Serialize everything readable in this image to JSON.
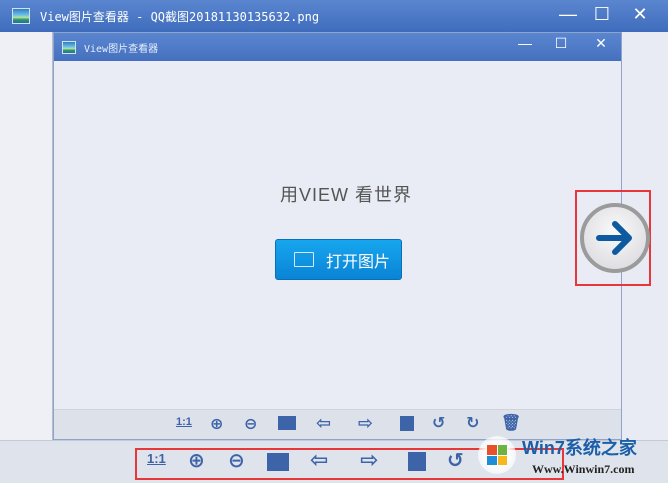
{
  "window": {
    "title": "View图片查看器 - QQ截图20181130135632.png",
    "minimize": "—",
    "maximize": "☐",
    "close": "✕"
  },
  "inner_window": {
    "title": "View图片查看器",
    "minimize": "—",
    "maximize": "☐",
    "close": "✕"
  },
  "main": {
    "slogan": "用VIEW 看世界",
    "open_button": "打开图片"
  },
  "toolbar": {
    "actual_size": "1:1",
    "items": [
      "actual-size",
      "zoom-in",
      "zoom-out",
      "open-folder",
      "previous",
      "next",
      "save",
      "rotate-left",
      "rotate-right",
      "delete"
    ]
  },
  "watermark": {
    "brand": "Win7系统之家",
    "url": "Www.Winwin7.com"
  },
  "colors": {
    "titlebar": "#4a76c4",
    "accent": "#0a84d6",
    "highlight": "#e8373a",
    "icon": "#3d64a8"
  }
}
